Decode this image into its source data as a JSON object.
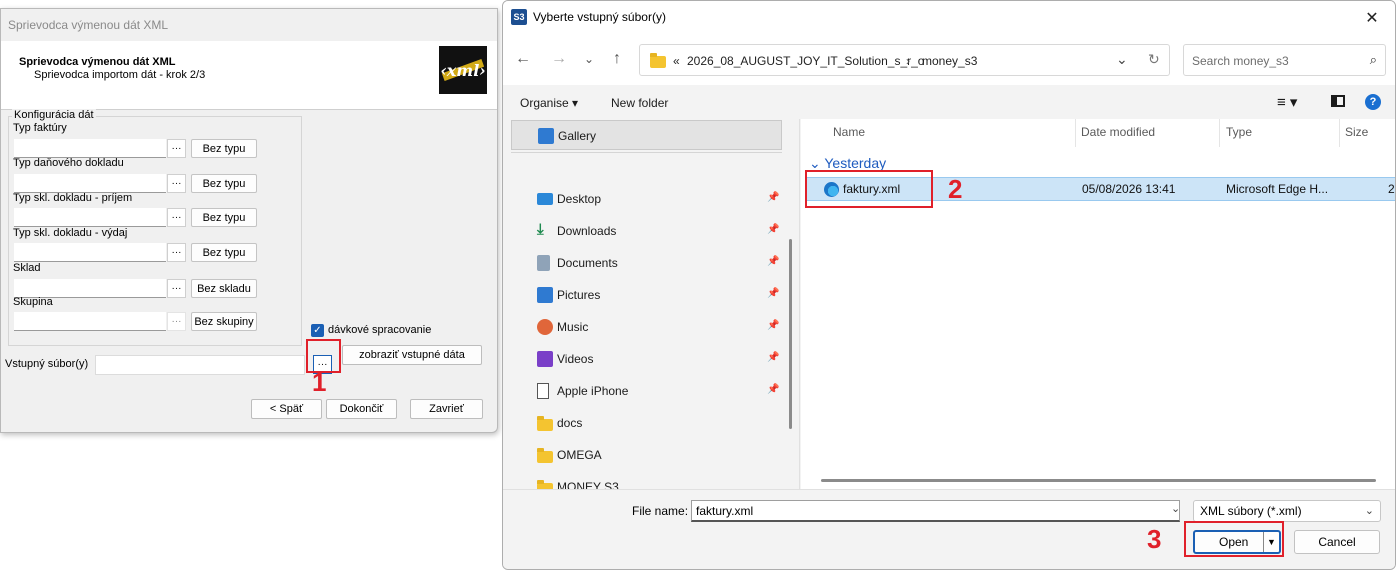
{
  "wizard": {
    "window_title": "Sprievodca výmenou dát XML",
    "header_title": "Sprievodca výmenou dát XML",
    "header_subtitle": "Sprievodca importom dát - krok 2/3",
    "logo_text": "‹xml›",
    "group_title": "Konfigurácia dát",
    "fields": [
      {
        "label": "Typ faktúry",
        "button": "Bez typu"
      },
      {
        "label": "Typ daňového dokladu",
        "button": "Bez typu"
      },
      {
        "label": "Typ skl. dokladu - príjem",
        "button": "Bez typu"
      },
      {
        "label": "Typ skl. dokladu - výdaj",
        "button": "Bez typu"
      },
      {
        "label": "Sklad",
        "button": "Bez skladu"
      },
      {
        "label": "Skupina",
        "button": "Bez skupiny"
      }
    ],
    "dots_label": "···",
    "batch_checkbox_label": "dávkové spracovanie",
    "batch_checked": true,
    "input_file_label": "Vstupný súbor(y)",
    "input_file_value": "",
    "show_data_button": "zobraziť vstupné dáta",
    "back_button": "< Späť",
    "finish_button": "Dokončiť",
    "close_button": "Zavrieť"
  },
  "annotations": {
    "step1": "1",
    "step2": "2",
    "step3": "3",
    "color": "#e0202a"
  },
  "dialog": {
    "title": "Vyberte vstupný súbor(y)",
    "app_icon": "S3",
    "address": {
      "prefix": "«",
      "crumbs": [
        "2026_08_AUGUST_JOY_IT_Solution_s_r_o",
        "money_s3"
      ],
      "separator": "›"
    },
    "search_placeholder": "Search money_s3",
    "commands": {
      "organise": "Organise ▾",
      "new_folder": "New folder"
    },
    "nav_items": [
      {
        "label": "Gallery",
        "icon": "gallery-icon",
        "selected": true,
        "pinned": false
      },
      {
        "label": "Desktop",
        "icon": "desktop-icon",
        "selected": false,
        "pinned": true
      },
      {
        "label": "Downloads",
        "icon": "downloads-icon",
        "selected": false,
        "pinned": true
      },
      {
        "label": "Documents",
        "icon": "documents-icon",
        "selected": false,
        "pinned": true
      },
      {
        "label": "Pictures",
        "icon": "pictures-icon",
        "selected": false,
        "pinned": true
      },
      {
        "label": "Music",
        "icon": "music-icon",
        "selected": false,
        "pinned": true
      },
      {
        "label": "Videos",
        "icon": "videos-icon",
        "selected": false,
        "pinned": true
      },
      {
        "label": "Apple iPhone",
        "icon": "phone-icon",
        "selected": false,
        "pinned": true
      },
      {
        "label": "docs",
        "icon": "folder-icon",
        "selected": false,
        "pinned": false
      },
      {
        "label": "OMEGA",
        "icon": "folder-icon",
        "selected": false,
        "pinned": false
      },
      {
        "label": "MONEY S3",
        "icon": "folder-icon",
        "selected": false,
        "pinned": false
      }
    ],
    "columns": {
      "name": "Name",
      "date_modified": "Date modified",
      "type": "Type",
      "size": "Size"
    },
    "group_label": "Yesterday",
    "files": [
      {
        "name": "faktury.xml",
        "date": "05/08/2026 13:41",
        "type": "Microsoft Edge H...",
        "size": "2",
        "icon": "edge-icon"
      }
    ],
    "file_name_label": "File name:",
    "file_name_value": "faktury.xml",
    "file_type": "XML súbory (*.xml)",
    "open_button": "Open",
    "cancel_button": "Cancel"
  }
}
